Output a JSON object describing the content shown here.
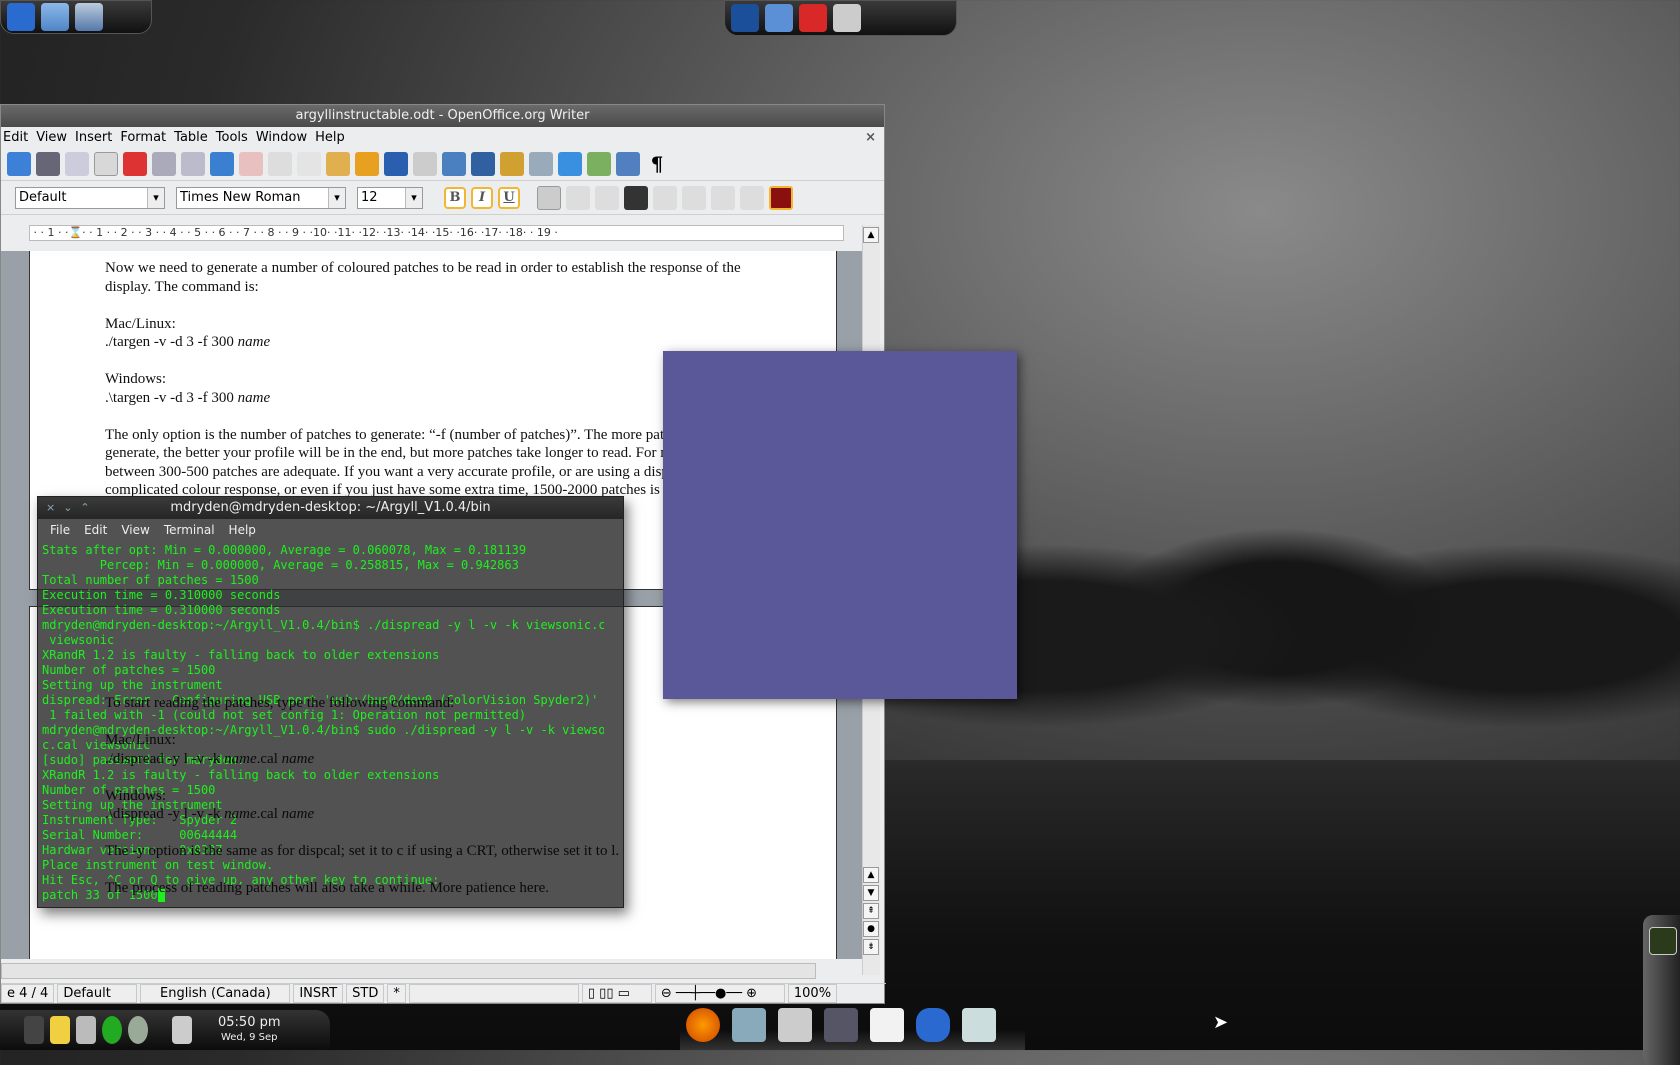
{
  "desktop": {
    "top_left_panel": [
      "kde-menu",
      "favorites-folder",
      "network"
    ],
    "top_center_panel": [
      "mail",
      "browser-folder",
      "red-folder",
      "removable-drive"
    ]
  },
  "writer": {
    "title": "argyllinstructable.odt - OpenOffice.org Writer",
    "menu": [
      "Edit",
      "View",
      "Insert",
      "Format",
      "Table",
      "Tools",
      "Window",
      "Help"
    ],
    "style_value": "Default",
    "font_value": "Times New Roman",
    "size_value": "12",
    "format_buttons": [
      "B",
      "I",
      "U"
    ],
    "ruler": " · · 1 · ·⌛· · 1 · · 2 · · 3 · · 4 · · 5 · · 6 · · 7 · · 8 · · 9 · ·10· ·11· ·12· ·13· ·14· ·15· ·16· ·17· ·18· · 19 ·",
    "page1": [
      "Now we need to generate a number of coloured patches to be read in order to establish the response of the display.  The command is:",
      "Mac/Linux:",
      "./targen -v -d 3 -f 300",
      "Windows:",
      ".\\targen -v -d 3 -f 300",
      "The only option is the number of patches to generate: “-f (number of patches)”. The more patches you generate, the better your profile will be in the end, but more patches take longer to read. For most people between 300-500 patches are adequate. If you want a very accurate profile, or are using a display that has a complicated colour response, or even if you just have some extra time, 1500-2000 patches is not unreasonable."
    ],
    "italic_name": "name",
    "page2": {
      "intro": "To start reading the patches, type the following command:",
      "mac": "Mac/Linux:",
      "mac_cmd": "./dispread -y l -v -k",
      "win": "Windows:",
      "win_cmd": ".\\dispread -y l -v -k",
      "cal": ".cal",
      "y_option": "The -y option is the same as for dispcal; set it to c if using a CRT, otherwise set it to l.",
      "process": "The process of reading patches will also take a while. More patience here."
    },
    "status": {
      "page": "e 4 / 4",
      "style": "Default",
      "language": "English (Canada)",
      "mode": "INSRT",
      "selection": "STD",
      "modified": "*",
      "zoom": "100%"
    },
    "zoom_percent": 100
  },
  "terminal": {
    "title": "mdryden@mdryden-desktop: ~/Argyll_V1.0.4/bin",
    "menu": [
      "File",
      "Edit",
      "View",
      "Terminal",
      "Help"
    ],
    "lines": [
      "Stats after opt: Min = 0.000000, Average = 0.060078, Max = 0.181139",
      "        Percep: Min = 0.000000, Average = 0.258815, Max = 0.942863",
      "Total number of patches = 1500",
      "Execution time = 0.310000 seconds",
      "Execution time = 0.310000 seconds",
      "mdryden@mdryden-desktop:~/Argyll_V1.0.4/bin$ ./dispread -y l -v -k viewsonic.cal",
      " viewsonic",
      "XRandR 1.2 is faulty - falling back to older extensions",
      "Number of patches = 1500",
      "Setting up the instrument",
      "dispread: Error - Configuring USB port 'usb:/bus0/dev0 (ColorVision Spyder2)' to",
      " 1 failed with -1 (could not set config 1: Operation not permitted)",
      "mdryden@mdryden-desktop:~/Argyll_V1.0.4/bin$ sudo ./dispread -y l -v -k viewsoni",
      "c.cal viewsonic",
      "[sudo] password for mdryden:",
      "XRandR 1.2 is faulty - falling back to older extensions",
      "Number of patches = 1500",
      "Setting up the instrument",
      "Instrument Type:   Spyder 2",
      "Serial Number:     00644444",
      "Hardwar version:   0x0307",
      "Place instrument on test window.",
      "Hit Esc, ^C or Q to give up, any other key to continue:"
    ],
    "last_line": "patch 33 of 1500",
    "text_color": "#1ef01e"
  },
  "patch_window": {
    "color": "#5b5899"
  },
  "taskbar": {
    "time": "05:50 pm",
    "date": "Wed, 9 Sep",
    "dock": [
      "firefox",
      "contacts",
      "media-player",
      "terminal",
      "pointer",
      "frog-app",
      "text-editor"
    ]
  }
}
